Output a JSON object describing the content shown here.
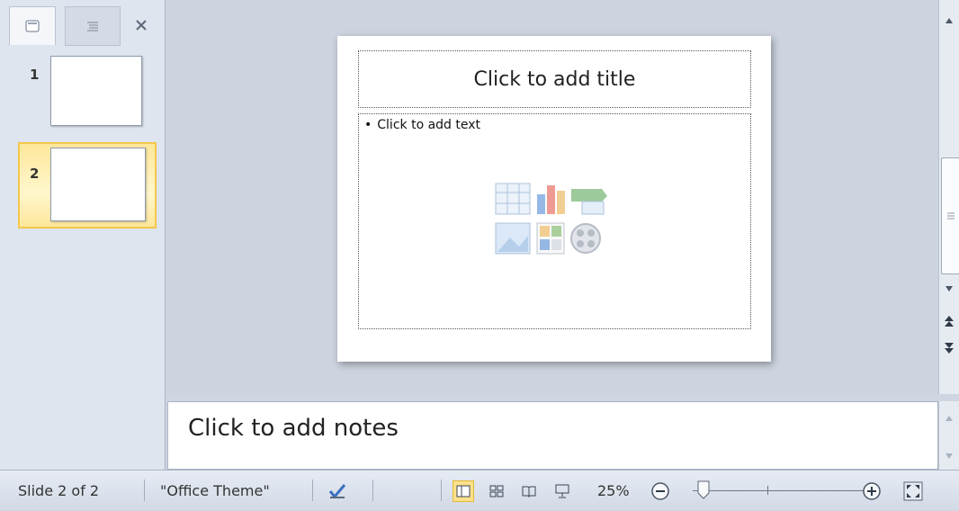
{
  "thumbnails": [
    {
      "number": "1",
      "selected": false
    },
    {
      "number": "2",
      "selected": true
    }
  ],
  "slide": {
    "title_placeholder": "Click to add title",
    "body_placeholder": "Click to add text"
  },
  "notes": {
    "placeholder": "Click to add notes"
  },
  "status_bar": {
    "slide_position": "Slide 2 of 2",
    "theme": "\"Office Theme\"",
    "zoom": "25%"
  },
  "colors": {
    "selection_fill": "#fde79a",
    "selection_border": "#f5c84b"
  },
  "icons": [
    "close-icon",
    "slides-tab-icon",
    "outline-tab-icon",
    "spell-check-icon",
    "normal-view-icon",
    "slide-sorter-icon",
    "reading-view-icon",
    "slideshow-icon",
    "zoom-out-icon",
    "zoom-in-icon",
    "fit-to-window-icon"
  ]
}
